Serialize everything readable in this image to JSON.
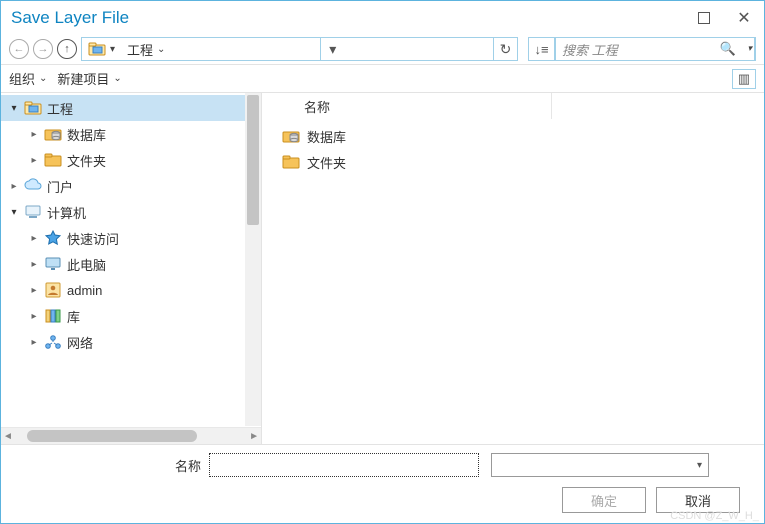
{
  "window": {
    "title": "Save Layer File"
  },
  "nav": {
    "current": "工程"
  },
  "search": {
    "placeholder": "搜索 工程"
  },
  "options": {
    "organize": "组织",
    "newitem": "新建项目"
  },
  "tree": [
    {
      "indent": 0,
      "expand": "open",
      "icon": "folder-map",
      "label": "工程",
      "selected": true
    },
    {
      "indent": 1,
      "expand": "closed",
      "icon": "database",
      "label": "数据库"
    },
    {
      "indent": 1,
      "expand": "closed",
      "icon": "folder",
      "label": "文件夹"
    },
    {
      "indent": 0,
      "expand": "closed",
      "icon": "cloud",
      "label": "门户"
    },
    {
      "indent": 0,
      "expand": "open",
      "icon": "computer",
      "label": "计算机"
    },
    {
      "indent": 1,
      "expand": "closed",
      "icon": "star",
      "label": "快速访问"
    },
    {
      "indent": 1,
      "expand": "closed",
      "icon": "monitor",
      "label": "此电脑"
    },
    {
      "indent": 1,
      "expand": "closed",
      "icon": "user",
      "label": "admin"
    },
    {
      "indent": 1,
      "expand": "closed",
      "icon": "libraries",
      "label": "库"
    },
    {
      "indent": 1,
      "expand": "closed",
      "icon": "network",
      "label": "网络"
    }
  ],
  "content": {
    "header": "名称",
    "rows": [
      {
        "icon": "database",
        "label": "数据库"
      },
      {
        "icon": "folder",
        "label": "文件夹"
      }
    ]
  },
  "footer": {
    "name_label": "名称",
    "name_value": "",
    "ok": "确定",
    "cancel": "取消"
  },
  "watermark": "CSDN @Z_W_H_"
}
